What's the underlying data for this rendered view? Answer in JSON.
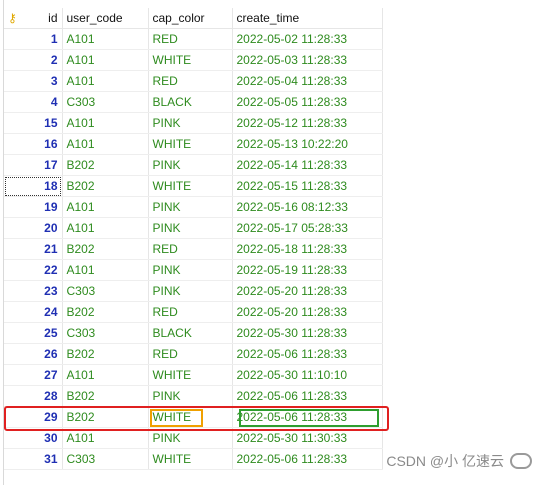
{
  "columns": {
    "id": "id",
    "user_code": "user_code",
    "cap_color": "cap_color",
    "create_time": "create_time"
  },
  "rows": [
    {
      "id": "1",
      "user_code": "A101",
      "cap_color": "RED",
      "create_time": "2022-05-02 11:28:33"
    },
    {
      "id": "2",
      "user_code": "A101",
      "cap_color": "WHITE",
      "create_time": "2022-05-03 11:28:33"
    },
    {
      "id": "3",
      "user_code": "A101",
      "cap_color": "RED",
      "create_time": "2022-05-04 11:28:33"
    },
    {
      "id": "4",
      "user_code": "C303",
      "cap_color": "BLACK",
      "create_time": "2022-05-05 11:28:33"
    },
    {
      "id": "15",
      "user_code": "A101",
      "cap_color": "PINK",
      "create_time": "2022-05-12 11:28:33"
    },
    {
      "id": "16",
      "user_code": "A101",
      "cap_color": "WHITE",
      "create_time": "2022-05-13 10:22:20"
    },
    {
      "id": "17",
      "user_code": "B202",
      "cap_color": "PINK",
      "create_time": "2022-05-14 11:28:33"
    },
    {
      "id": "18",
      "user_code": "B202",
      "cap_color": "WHITE",
      "create_time": "2022-05-15 11:28:33"
    },
    {
      "id": "19",
      "user_code": "A101",
      "cap_color": "PINK",
      "create_time": "2022-05-16 08:12:33"
    },
    {
      "id": "20",
      "user_code": "A101",
      "cap_color": "PINK",
      "create_time": "2022-05-17 05:28:33"
    },
    {
      "id": "21",
      "user_code": "B202",
      "cap_color": "RED",
      "create_time": "2022-05-18 11:28:33"
    },
    {
      "id": "22",
      "user_code": "A101",
      "cap_color": "PINK",
      "create_time": "2022-05-19 11:28:33"
    },
    {
      "id": "23",
      "user_code": "C303",
      "cap_color": "PINK",
      "create_time": "2022-05-20 11:28:33"
    },
    {
      "id": "24",
      "user_code": "B202",
      "cap_color": "RED",
      "create_time": "2022-05-20 11:28:33"
    },
    {
      "id": "25",
      "user_code": "C303",
      "cap_color": "BLACK",
      "create_time": "2022-05-30 11:28:33"
    },
    {
      "id": "26",
      "user_code": "B202",
      "cap_color": "RED",
      "create_time": "2022-05-06 11:28:33"
    },
    {
      "id": "27",
      "user_code": "A101",
      "cap_color": "WHITE",
      "create_time": "2022-05-30 11:10:10"
    },
    {
      "id": "28",
      "user_code": "B202",
      "cap_color": "PINK",
      "create_time": "2022-05-06 11:28:33"
    },
    {
      "id": "29",
      "user_code": "B202",
      "cap_color": "WHITE",
      "create_time": "2022-05-06 11:28:33"
    },
    {
      "id": "30",
      "user_code": "A101",
      "cap_color": "PINK",
      "create_time": "2022-05-30 11:30:33"
    },
    {
      "id": "31",
      "user_code": "C303",
      "cap_color": "WHITE",
      "create_time": "2022-05-06 11:28:33"
    }
  ],
  "watermark": "CSDN @小  亿速云",
  "icons": {
    "primary_key": "key-icon",
    "brand": "cloud-icon"
  },
  "colors": {
    "id_text": "#1f2fb3",
    "value_text": "#2e8b1e",
    "highlight_row": "#e02020",
    "highlight_cap": "#f0a000",
    "highlight_time": "#2e9e2e"
  }
}
